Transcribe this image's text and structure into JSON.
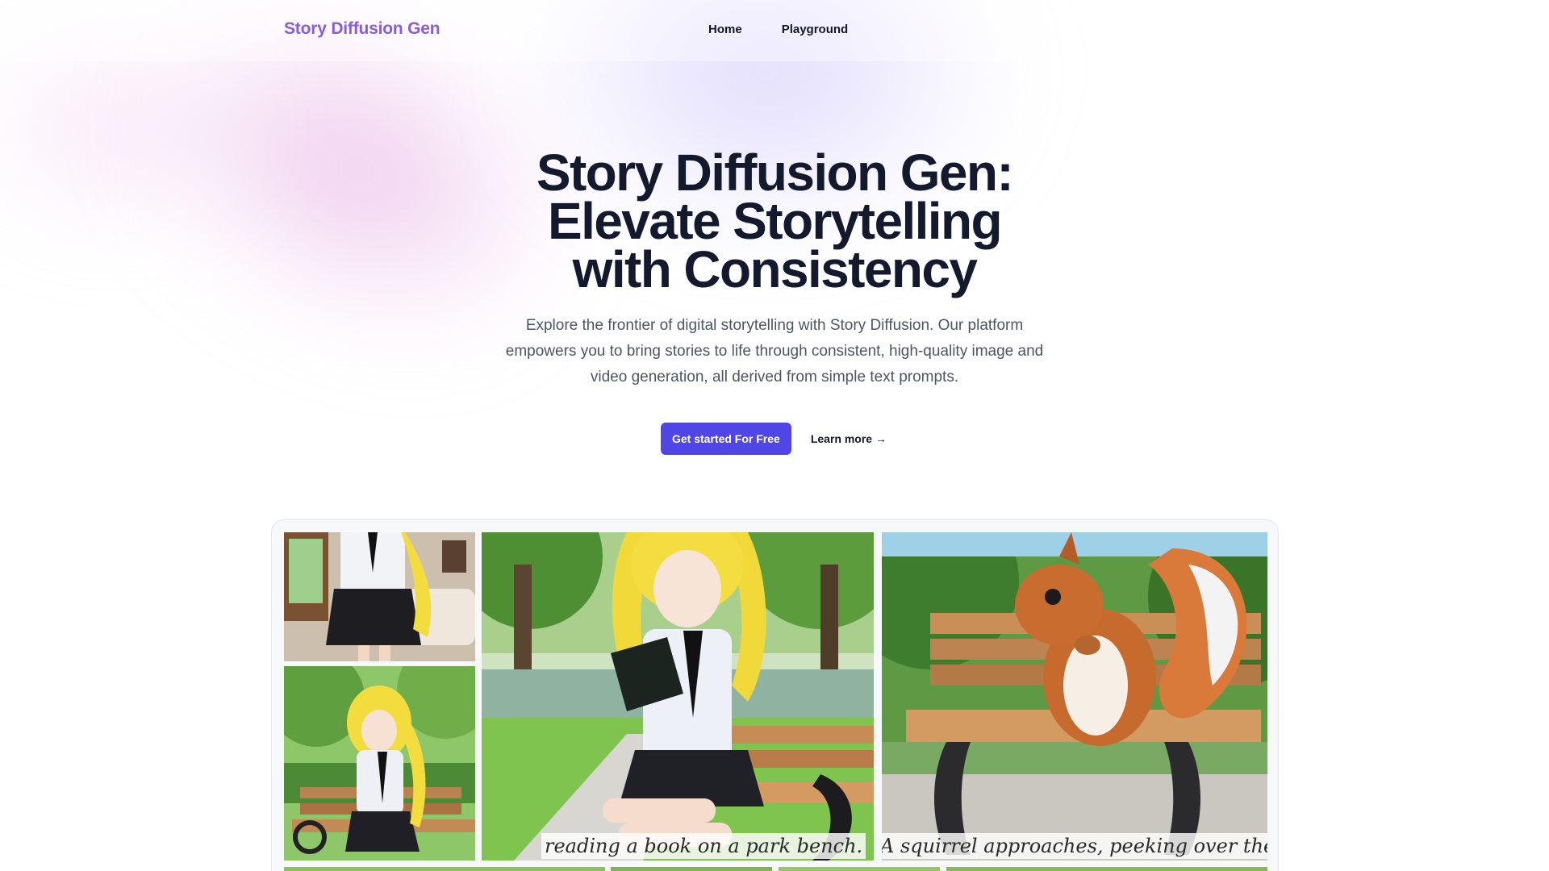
{
  "header": {
    "logo": "Story Diffusion Gen",
    "nav": [
      "Home",
      "Playground"
    ]
  },
  "hero": {
    "title_lines": [
      "Story Diffusion Gen:",
      "Elevate Storytelling",
      "with Consistency"
    ],
    "description": "Explore the frontier of digital storytelling with Story Diffusion. Our platform empowers you to bring stories to life through consistent, high-quality image and video generation, all derived from simple text prompts.",
    "primary_cta": "Get started For Free",
    "secondary_cta": "Learn more →"
  },
  "gallery": {
    "captions": [
      "reading a book on a park bench.",
      "A squirrel approaches, peeking over the bench"
    ]
  },
  "colors": {
    "brand": "#8a5cd6",
    "primary_button": "#4f46e5",
    "heading": "#141a2e",
    "body_text": "#4b5563"
  }
}
